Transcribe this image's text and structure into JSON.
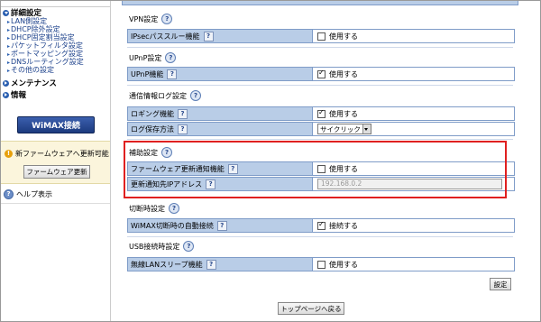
{
  "sidebar": {
    "advanced_header": "詳細設定",
    "items": [
      {
        "label": "LAN側設定"
      },
      {
        "label": "DHCP除外設定"
      },
      {
        "label": "DHCP固定割当設定"
      },
      {
        "label": "パケットフィルタ設定"
      },
      {
        "label": "ポートマッピング設定"
      },
      {
        "label": "DNSルーティング設定"
      },
      {
        "label": "その他の設定"
      }
    ],
    "maintenance_header": "メンテナンス",
    "info_header": "情報",
    "wimax_button": "WiMAX接続",
    "notice_text": "新ファームウェアへ更新可能",
    "firmware_button": "ファームウェア更新",
    "help_label": "ヘルプ表示"
  },
  "sections": {
    "vpn": {
      "title": "VPN設定",
      "row_label": "IPsecパススルー機能",
      "value_label": "使用する",
      "checked": false
    },
    "upnp": {
      "title": "UPnP設定",
      "row_label": "UPnP機能",
      "value_label": "使用する",
      "checked": true
    },
    "log": {
      "title": "通信情報ログ設定",
      "logging_label": "ロギング機能",
      "logging_value": "使用する",
      "logging_checked": true,
      "storage_label": "ログ保存方法",
      "storage_value": "サイクリック"
    },
    "aux": {
      "title": "補助設定",
      "notify_label": "ファームウェア更新通知機能",
      "notify_value": "使用する",
      "notify_checked": false,
      "ip_label": "更新通知先IPアドレス",
      "ip_placeholder": "192.168.0.2"
    },
    "disconnect": {
      "title": "切断時設定",
      "row_label": "WiMAX切断時の自動接続",
      "value_label": "接続する",
      "checked": true
    },
    "usb": {
      "title": "USB接続時設定",
      "row_label": "無線LANスリープ機能",
      "value_label": "使用する",
      "checked": false
    }
  },
  "buttons": {
    "set": "設定",
    "top_page": "トップページへ戻る"
  },
  "help_glyph": "?",
  "icons": {
    "help": "question-icon",
    "notice": "info-icon",
    "section_arrow": "arrow-right-icon"
  },
  "colors": {
    "label_bg": "#b9cde7",
    "border": "#7f9cc8",
    "highlight": "#e02020",
    "wimax_button": "#1c3a7e"
  }
}
